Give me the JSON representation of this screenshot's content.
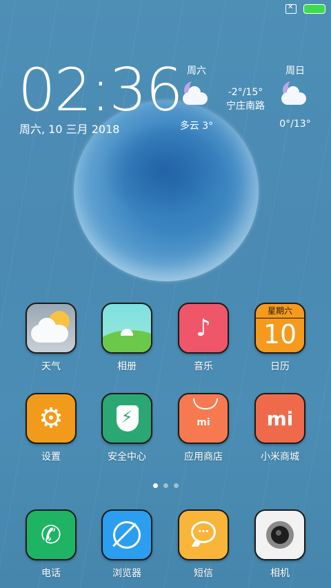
{
  "clock": {
    "time": "02:36",
    "date": "周六, 10 三月 2018"
  },
  "weather_today": {
    "day": "周六",
    "range": "-2°/15°",
    "location": "宁庄南路",
    "condition": "多云 3°"
  },
  "weather_next": {
    "day": "周日",
    "temp": "0°/13°"
  },
  "calendar_icon": {
    "weekday": "星期六",
    "day": "10"
  },
  "apps_row1": [
    {
      "label": "天气"
    },
    {
      "label": "相册"
    },
    {
      "label": "音乐"
    },
    {
      "label": "日历"
    }
  ],
  "apps_row2": [
    {
      "label": "设置"
    },
    {
      "label": "安全中心"
    },
    {
      "label": "应用商店"
    },
    {
      "label": "小米商城"
    }
  ],
  "dock": [
    {
      "label": "电话"
    },
    {
      "label": "浏览器"
    },
    {
      "label": "短信"
    },
    {
      "label": "相机"
    }
  ],
  "page_indicator": {
    "count": 3,
    "active": 1
  },
  "colors": {
    "background": "#4a8ab3",
    "music": "#f0566a",
    "calendar": "#f59a1c",
    "settings": "#f29a1b",
    "security": "#2aa772",
    "appstore": "#f7794f",
    "mistore": "#ef6a4b",
    "phone": "#1fb463",
    "browser": "#2b9ef0",
    "message": "#f8b53a",
    "camera": "#f2f2f2"
  }
}
